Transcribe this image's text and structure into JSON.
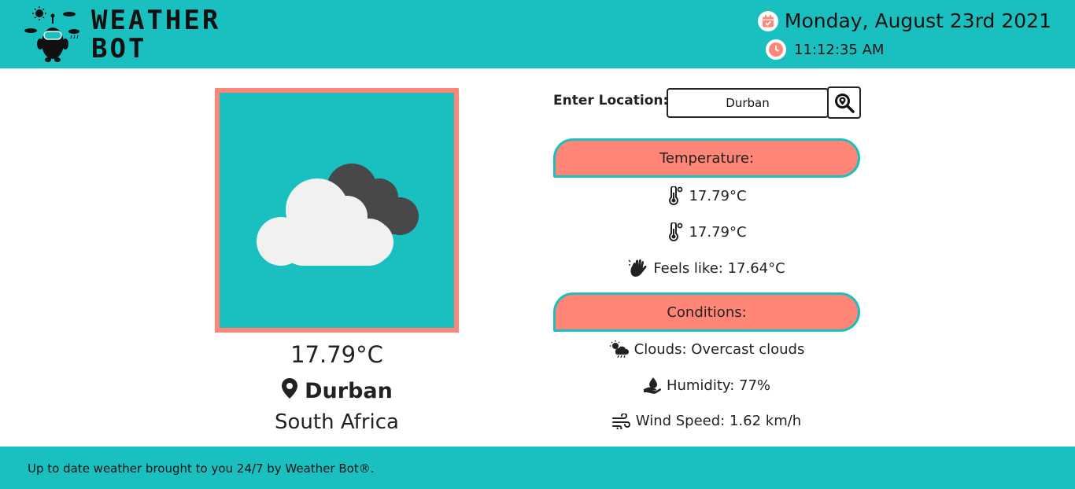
{
  "header": {
    "brand_line1": "WEATHER",
    "brand_line2": "BOT",
    "date": "Monday, August 23rd 2021",
    "time": "11:12:35 AM"
  },
  "current": {
    "temperature": "17.79°C",
    "city": "Durban",
    "country": "South Africa",
    "condition_icon": "partly-cloudy-icon"
  },
  "search": {
    "label": "Enter Location:",
    "value": "Durban"
  },
  "temperature_section": {
    "title": "Temperature:",
    "items": [
      {
        "icon": "thermometer-icon",
        "text": "17.79°C"
      },
      {
        "icon": "thermometer-icon",
        "text": "17.79°C"
      },
      {
        "icon": "hand-icon",
        "text": "Feels like: 17.64°C"
      }
    ]
  },
  "conditions_section": {
    "title": "Conditions:",
    "items": [
      {
        "icon": "cloud-sun-rain-icon",
        "text": "Clouds: Overcast clouds"
      },
      {
        "icon": "hand-droplet-icon",
        "text": "Humidity: 77%"
      },
      {
        "icon": "wind-icon",
        "text": "Wind Speed: 1.62 km/h"
      }
    ]
  },
  "footer": {
    "text": "Up to date weather brought to you 24/7 by Weather Bot®."
  },
  "colors": {
    "teal": "#19c0bf",
    "coral": "#ff8576",
    "cloud_light": "#f1f1ef",
    "cloud_dark": "#48474a"
  }
}
